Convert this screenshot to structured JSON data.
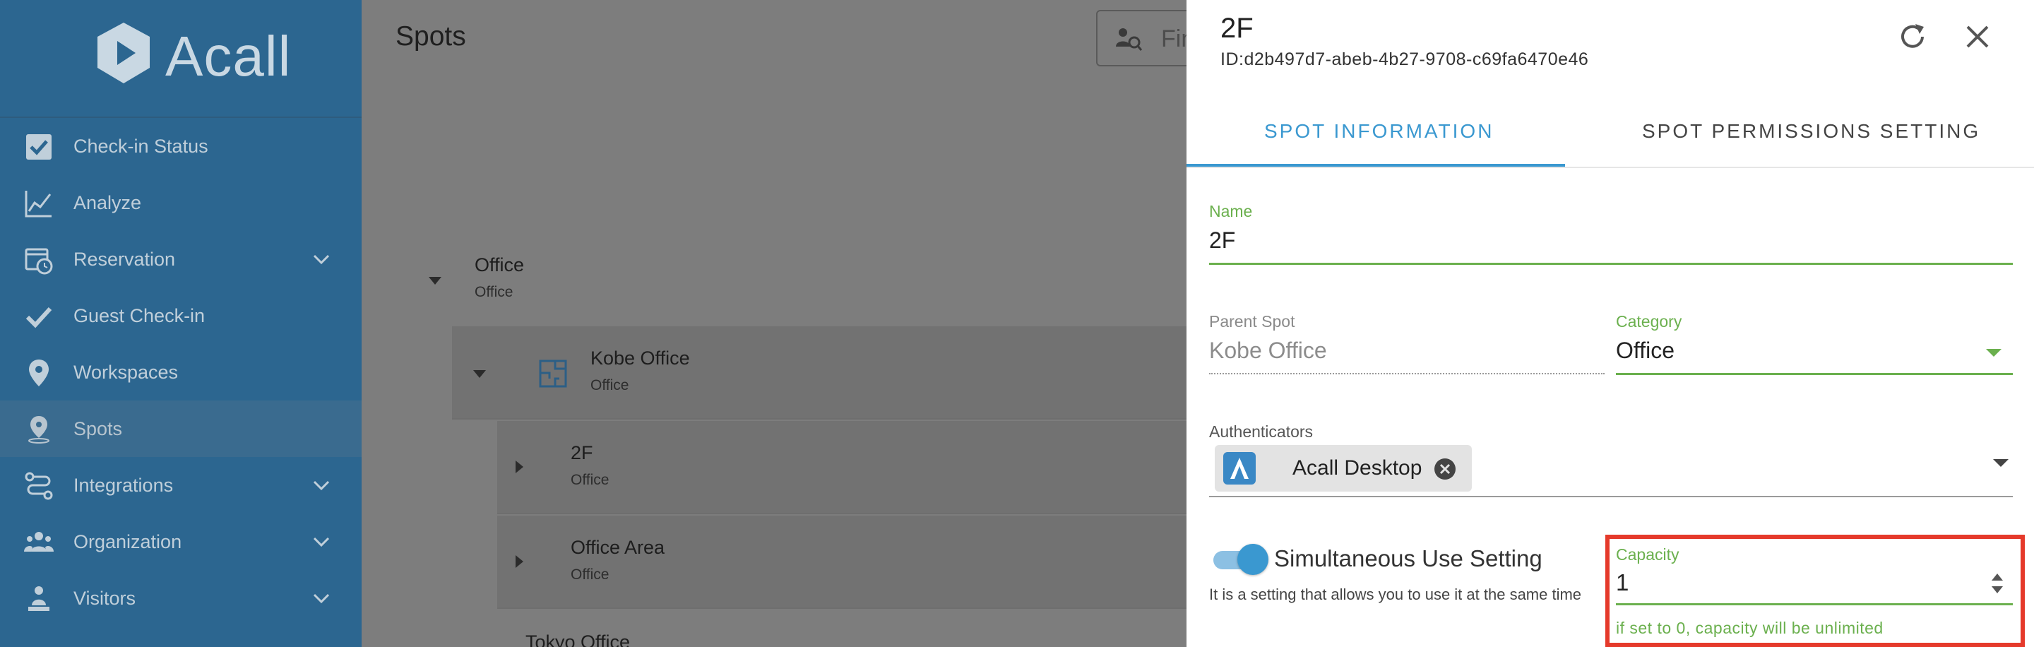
{
  "sidebar": {
    "logo_text": "Acall",
    "items": [
      {
        "label": "Check-in Status",
        "icon": "checkbox-icon",
        "has_chevron": false
      },
      {
        "label": "Analyze",
        "icon": "chart-line-icon",
        "has_chevron": false
      },
      {
        "label": "Reservation",
        "icon": "calendar-clock-icon",
        "has_chevron": true
      },
      {
        "label": "Guest Check-in",
        "icon": "checkmark-icon",
        "has_chevron": false
      },
      {
        "label": "Workspaces",
        "icon": "map-pin-icon",
        "has_chevron": false
      },
      {
        "label": "Spots",
        "icon": "location-pin-icon",
        "has_chevron": false,
        "active": true
      },
      {
        "label": "Integrations",
        "icon": "integrations-icon",
        "has_chevron": true
      },
      {
        "label": "Organization",
        "icon": "people-icon",
        "has_chevron": true
      },
      {
        "label": "Visitors",
        "icon": "visitor-icon",
        "has_chevron": true
      }
    ]
  },
  "main": {
    "title": "Spots",
    "search_placeholder": "Fin",
    "tree": [
      {
        "name": "Office",
        "type": "Office",
        "expanded": true
      },
      {
        "name": "Kobe Office",
        "type": "Office",
        "expanded": true
      },
      {
        "name": "2F",
        "type": "Office",
        "expanded": false
      },
      {
        "name": "Office Area",
        "type": "Office",
        "expanded": false
      },
      {
        "name": "Tokyo Office",
        "type": ""
      }
    ]
  },
  "panel": {
    "title": "2F",
    "id": "ID:d2b497d7-abeb-4b27-9708-c69fa6470e46",
    "tabs": [
      {
        "label": "SPOT INFORMATION",
        "active": true
      },
      {
        "label": "SPOT PERMISSIONS SETTING",
        "active": false
      }
    ],
    "name_label": "Name",
    "name_value": "2F",
    "parent_label": "Parent Spot",
    "parent_value": "Kobe Office",
    "category_label": "Category",
    "category_value": "Office",
    "auth_label": "Authenticators",
    "auth_chip": "Acall Desktop",
    "simul_label": "Simultaneous Use Setting",
    "simul_enabled": true,
    "simul_desc": "It is a setting that allows you to use it at the same time",
    "capacity_label": "Capacity",
    "capacity_value": "1",
    "capacity_helper": "if set to 0, capacity will be unlimited"
  },
  "colors": {
    "sidebar_bg": "#2c6690",
    "accent_blue": "#3a98d0",
    "green": "#6bb04e",
    "highlight_red": "#e53a2b"
  }
}
